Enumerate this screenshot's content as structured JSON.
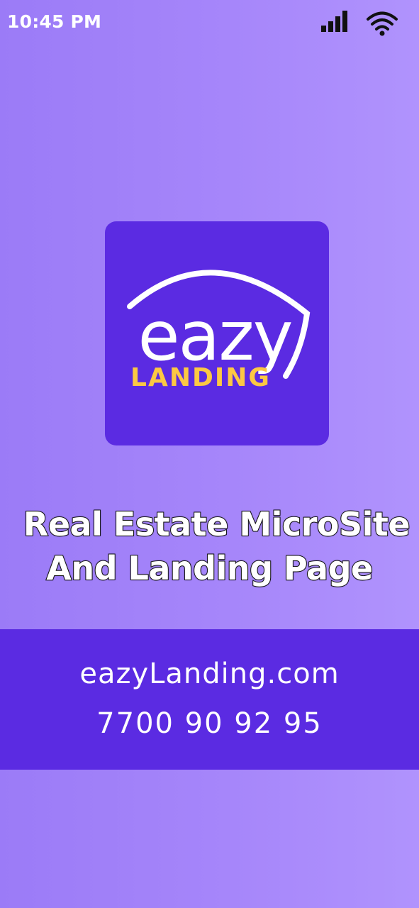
{
  "status_bar": {
    "time": "10:45 PM",
    "icons": [
      "signal-icon",
      "wifi-icon"
    ]
  },
  "logo": {
    "brand_top": "eazy",
    "brand_bottom": "LANDING",
    "colors": {
      "card": "#5b2be2",
      "brand_top": "#ffffff",
      "brand_bottom": "#fcc843"
    }
  },
  "tagline": {
    "line1": "Real Estate MicroSite",
    "line2": "And Landing Page"
  },
  "contact": {
    "website": "eazyLanding.com",
    "phone": "7700 90 92 95"
  },
  "colors": {
    "background": "#a686fa",
    "accent": "#5b2be2",
    "text": "#ffffff"
  }
}
